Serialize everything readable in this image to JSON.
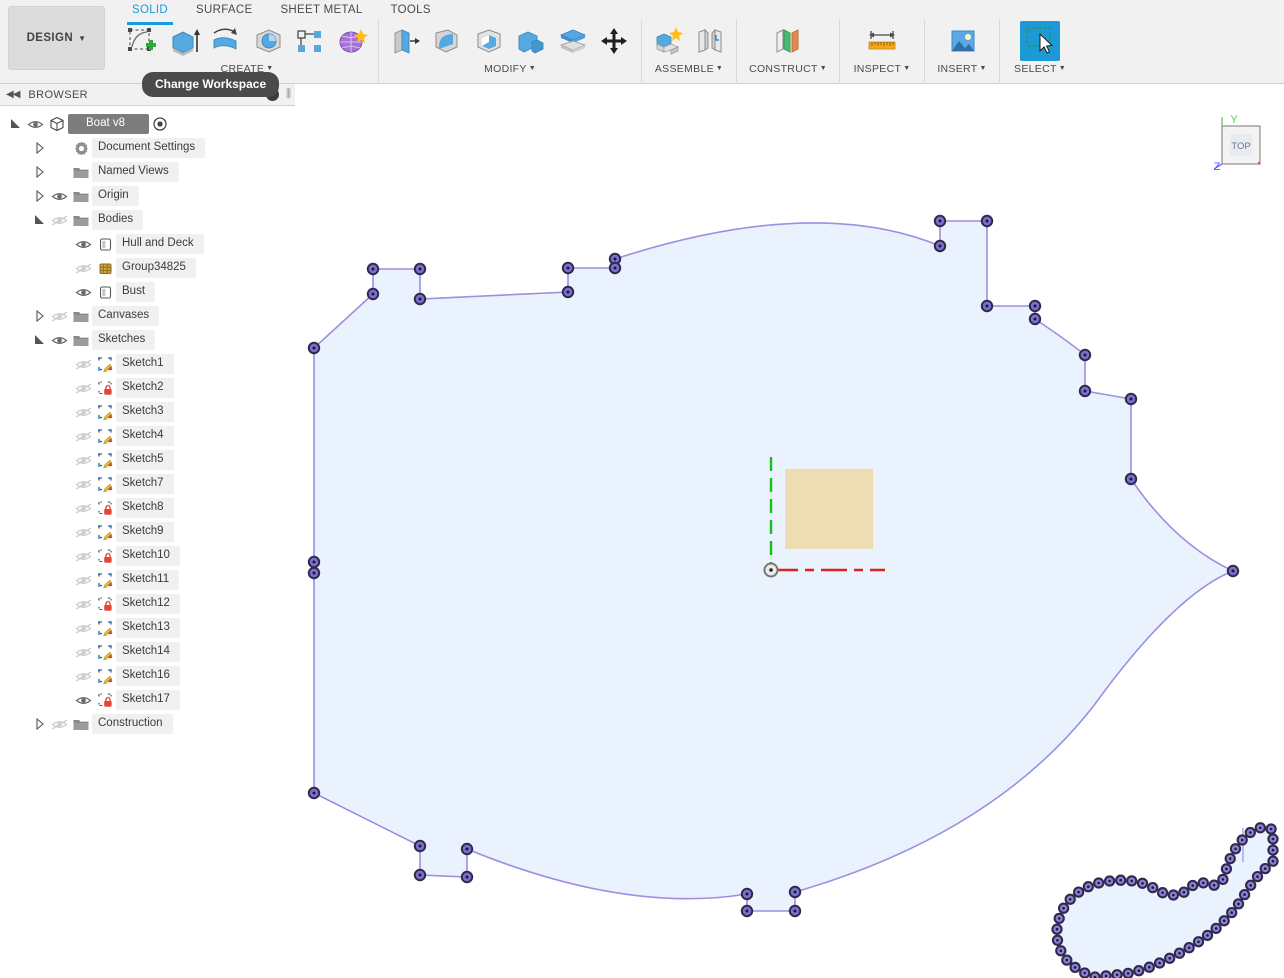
{
  "app": {
    "workspace_button": "DESIGN",
    "tooltip": "Change Workspace"
  },
  "toolbar": {
    "tabs": [
      {
        "label": "SOLID",
        "active": true
      },
      {
        "label": "SURFACE",
        "active": false
      },
      {
        "label": "SHEET METAL",
        "active": false
      },
      {
        "label": "TOOLS",
        "active": false
      }
    ],
    "groups": [
      {
        "label": "CREATE",
        "caret": true,
        "icons": [
          "create-sketch-icon",
          "extrude-icon",
          "revolve-icon",
          "sweep-icon",
          "pattern-icon",
          "form-icon"
        ]
      },
      {
        "label": "MODIFY",
        "caret": true,
        "icons": [
          "press-pull-icon",
          "fillet-icon",
          "shell-icon",
          "combine-icon",
          "offset-face-icon",
          "move-copy-icon"
        ]
      },
      {
        "label": "ASSEMBLE",
        "caret": true,
        "icons": [
          "new-component-icon",
          "joint-icon"
        ]
      },
      {
        "label": "CONSTRUCT",
        "caret": true,
        "icons": [
          "construct-plane-icon"
        ]
      },
      {
        "label": "INSPECT",
        "caret": true,
        "icons": [
          "measure-icon"
        ]
      },
      {
        "label": "INSERT",
        "caret": true,
        "icons": [
          "insert-image-icon"
        ]
      },
      {
        "label": "SELECT",
        "caret": true,
        "icons": [
          "select-window-icon"
        ]
      }
    ]
  },
  "browser": {
    "title": "BROWSER",
    "collapse_icon": "collapse-left-icon",
    "minimize_icon": "minus-circle-icon",
    "nodes": [
      {
        "label": "Boat v8",
        "depth": 0,
        "twisty": "open",
        "eye": "visible",
        "icon": "component-icon",
        "root": true,
        "dot": true
      },
      {
        "label": "Document Settings",
        "depth": 1,
        "twisty": "closed",
        "eye": "none",
        "icon": "gear-icon"
      },
      {
        "label": "Named Views",
        "depth": 1,
        "twisty": "closed",
        "eye": "none",
        "icon": "folder-icon"
      },
      {
        "label": "Origin",
        "depth": 1,
        "twisty": "closed",
        "eye": "visible",
        "icon": "folder-icon"
      },
      {
        "label": "Bodies",
        "depth": 1,
        "twisty": "open",
        "eye": "hidden",
        "icon": "folder-icon"
      },
      {
        "label": "Hull and Deck",
        "depth": 2,
        "twisty": "none",
        "eye": "visible",
        "icon": "body-icon"
      },
      {
        "label": "Group34825",
        "depth": 2,
        "twisty": "none",
        "eye": "hidden",
        "icon": "mesh-body-icon"
      },
      {
        "label": "Bust",
        "depth": 2,
        "twisty": "none",
        "eye": "visible",
        "icon": "body-icon"
      },
      {
        "label": "Canvases",
        "depth": 1,
        "twisty": "closed",
        "eye": "hidden",
        "icon": "folder-icon"
      },
      {
        "label": "Sketches",
        "depth": 1,
        "twisty": "open",
        "eye": "visible",
        "icon": "folder-icon"
      },
      {
        "label": "Sketch1",
        "depth": 2,
        "twisty": "none",
        "eye": "hidden",
        "icon": "sketch-icon"
      },
      {
        "label": "Sketch2",
        "depth": 2,
        "twisty": "none",
        "eye": "hidden",
        "icon": "sketch-locked-icon"
      },
      {
        "label": "Sketch3",
        "depth": 2,
        "twisty": "none",
        "eye": "hidden",
        "icon": "sketch-icon"
      },
      {
        "label": "Sketch4",
        "depth": 2,
        "twisty": "none",
        "eye": "hidden",
        "icon": "sketch-icon"
      },
      {
        "label": "Sketch5",
        "depth": 2,
        "twisty": "none",
        "eye": "hidden",
        "icon": "sketch-icon"
      },
      {
        "label": "Sketch7",
        "depth": 2,
        "twisty": "none",
        "eye": "hidden",
        "icon": "sketch-icon"
      },
      {
        "label": "Sketch8",
        "depth": 2,
        "twisty": "none",
        "eye": "hidden",
        "icon": "sketch-locked-icon"
      },
      {
        "label": "Sketch9",
        "depth": 2,
        "twisty": "none",
        "eye": "hidden",
        "icon": "sketch-icon"
      },
      {
        "label": "Sketch10",
        "depth": 2,
        "twisty": "none",
        "eye": "hidden",
        "icon": "sketch-locked-icon"
      },
      {
        "label": "Sketch11",
        "depth": 2,
        "twisty": "none",
        "eye": "hidden",
        "icon": "sketch-icon"
      },
      {
        "label": "Sketch12",
        "depth": 2,
        "twisty": "none",
        "eye": "hidden",
        "icon": "sketch-locked-icon"
      },
      {
        "label": "Sketch13",
        "depth": 2,
        "twisty": "none",
        "eye": "hidden",
        "icon": "sketch-icon"
      },
      {
        "label": "Sketch14",
        "depth": 2,
        "twisty": "none",
        "eye": "hidden",
        "icon": "sketch-icon"
      },
      {
        "label": "Sketch16",
        "depth": 2,
        "twisty": "none",
        "eye": "hidden",
        "icon": "sketch-icon"
      },
      {
        "label": "Sketch17",
        "depth": 2,
        "twisty": "none",
        "eye": "visible",
        "icon": "sketch-locked-icon"
      },
      {
        "label": "Construction",
        "depth": 1,
        "twisty": "closed",
        "eye": "hidden",
        "icon": "folder-icon"
      }
    ]
  },
  "viewcube": {
    "face_label": "TOP",
    "axis_y_label": "Y",
    "axis_z_label": "Z",
    "axis_y_color": "#49d049",
    "axis_z_color": "#5a5aff"
  },
  "canvas": {
    "background": "#ffffff",
    "sketch_fill": "#eaf3fd",
    "sketch_stroke": "#9b8fe0",
    "point_fill": "#7b6fd0",
    "point_ring": "#2f2a4d",
    "origin_x_axis_color": "#e02020",
    "origin_y_axis_color": "#19c019",
    "rect_fill": "#eedcb3",
    "origin_marker": "origin-point"
  }
}
